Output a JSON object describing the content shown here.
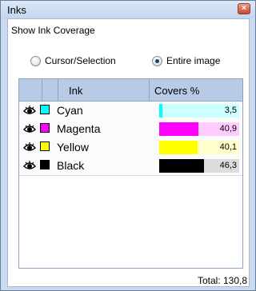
{
  "window": {
    "title": "Inks",
    "close_label": "×"
  },
  "panel": {
    "header": "Show Ink Coverage"
  },
  "mode": {
    "options": [
      {
        "label": "Cursor/Selection",
        "selected": false
      },
      {
        "label": "Entire image",
        "selected": true
      }
    ]
  },
  "table": {
    "columns": {
      "ink": "Ink",
      "covers": "Covers %"
    },
    "rows": [
      {
        "name": "Cyan",
        "swatch": "#00ffff",
        "tint": "#ccffff",
        "value": "3,5",
        "fraction": 0.035
      },
      {
        "name": "Magenta",
        "swatch": "#ff00ff",
        "tint": "#ffccff",
        "value": "40,9",
        "fraction": 0.409
      },
      {
        "name": "Yellow",
        "swatch": "#ffff00",
        "tint": "#ffffcc",
        "value": "40,1",
        "fraction": 0.401
      },
      {
        "name": "Black",
        "swatch": "#000000",
        "tint": "#dcdcdc",
        "value": "46,3",
        "fraction": 0.463
      }
    ]
  },
  "footer": {
    "total": "Total:  130,8"
  }
}
